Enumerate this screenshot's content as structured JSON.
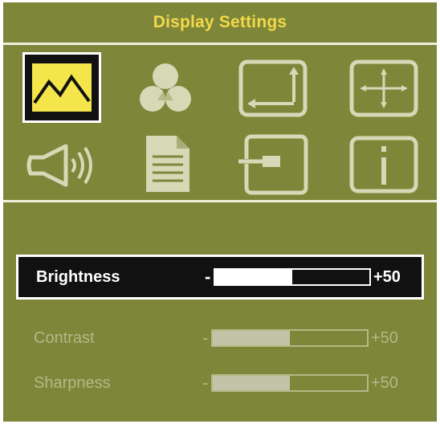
{
  "window": {
    "title": "Display Settings"
  },
  "menu_icons": [
    {
      "icon": "picture-icon",
      "selected": true
    },
    {
      "icon": "color-icon",
      "selected": false
    },
    {
      "icon": "geometry-icon",
      "selected": false
    },
    {
      "icon": "position-icon",
      "selected": false
    },
    {
      "icon": "audio-icon",
      "selected": false
    },
    {
      "icon": "document-icon",
      "selected": false
    },
    {
      "icon": "input-source-icon",
      "selected": false
    },
    {
      "icon": "information-icon",
      "selected": false
    }
  ],
  "settings": [
    {
      "label": "Brightness",
      "min_symbol": "-",
      "value_text": "+50",
      "level": 0.5,
      "active": true
    },
    {
      "label": "Contrast",
      "min_symbol": "-",
      "value_text": "+50",
      "level": 0.5,
      "active": false
    },
    {
      "label": "Sharpness",
      "min_symbol": "-",
      "value_text": "+50",
      "level": 0.5,
      "active": false
    }
  ],
  "colors": {
    "panel": "#7d8639",
    "title_text": "#f3d94a",
    "icon_line": "#d6d8b6",
    "picture_icon_fill": "#f3e54a"
  }
}
